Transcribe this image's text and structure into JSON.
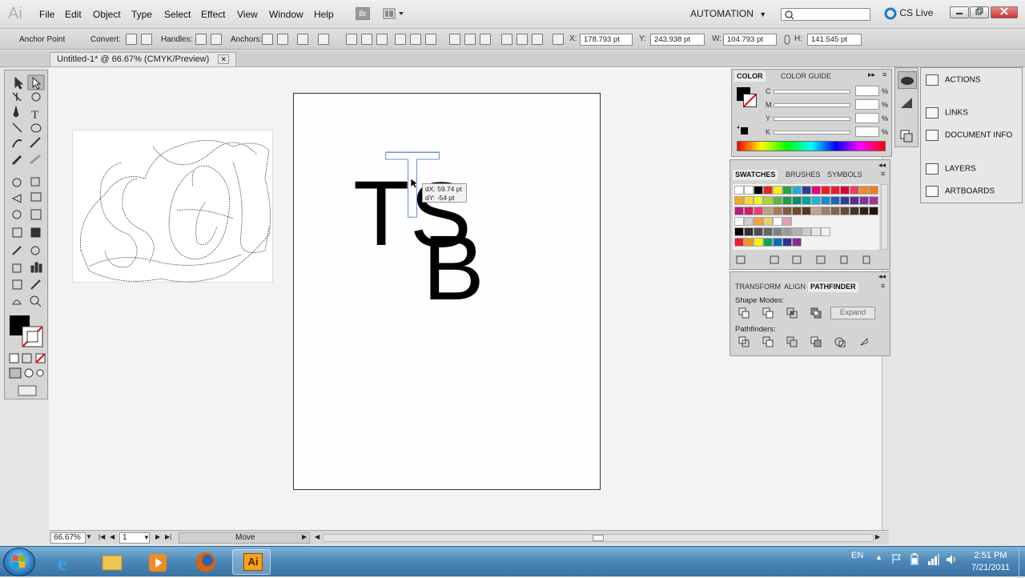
{
  "app": {
    "logo": "Ai",
    "bridge_label": "Br"
  },
  "menu": [
    "File",
    "Edit",
    "Object",
    "Type",
    "Select",
    "Effect",
    "View",
    "Window",
    "Help"
  ],
  "workspace": {
    "automation": "AUTOMATION",
    "cslive": "CS Live",
    "automation_arrow": "▼"
  },
  "control_bar": {
    "anchor_point": "Anchor Point",
    "convert": "Convert:",
    "handles": "Handles:",
    "anchors": "Anchors:",
    "x_label": "X:",
    "x_value": "178.793 pt",
    "y_label": "Y:",
    "y_value": "243.938 pt",
    "w_label": "W:",
    "w_value": "104.793 pt",
    "h_label": "H:",
    "h_value": "141.545 pt"
  },
  "document": {
    "tab_title": "Untitled-1* @ 66.67% (CMYK/Preview)",
    "tab_close": "✕"
  },
  "artwork": {
    "letter_t_outline": "T",
    "letter_t": "T",
    "letter_s": "S",
    "letter_b": "B",
    "tooltip_dx": "dX: 59.74 pt",
    "tooltip_dy": "dY: -54 pt"
  },
  "status": {
    "zoom": "66.67%",
    "page": "1",
    "tool_status": "Move"
  },
  "color_panel": {
    "tabs": [
      "COLOR",
      "COLOR GUIDE"
    ],
    "channels": [
      "C",
      "M",
      "Y",
      "K"
    ],
    "percent": "%"
  },
  "swatches_panel": {
    "tabs": [
      "SWATCHES",
      "BRUSHES",
      "SYMBOLS"
    ],
    "row1": [
      "#ffffff",
      "#ffffff",
      "#000000",
      "#e8241f",
      "#f7ec13",
      "#26a343",
      "#2aa7e0",
      "#2a3b91",
      "#e6007e",
      "#ed1c24",
      "#e71d36",
      "#d6003d",
      "#f03c5b",
      "#ee8b1f",
      "#f47b20"
    ],
    "row2": [
      "#f5a623",
      "#fdd835",
      "#eef230",
      "#b3d334",
      "#5cb543",
      "#1f9a48",
      "#0b8a63",
      "#02a09a",
      "#1fb2d6",
      "#1b8ccf",
      "#2163b3",
      "#2f3d92",
      "#5a2d91",
      "#7a3894",
      "#a3368e"
    ],
    "row3": [
      "#c2187d",
      "#d11e5a",
      "#e63e6d",
      "#c29d7a",
      "#a8795a",
      "#87593e",
      "#6e4a32",
      "#553722",
      "#bfa78d",
      "#9b8166",
      "#7a654e",
      "#5d4c3a",
      "#423427",
      "#2f241b",
      "#1e1711"
    ],
    "row4": [
      "#ffffff",
      "#cfcfcf",
      "#f4a23a",
      "#e8d26a",
      "#ffffff",
      "#e3a0b8"
    ],
    "row5": [
      "#000000",
      "#333333",
      "#4d4d4d",
      "#666666",
      "#808080",
      "#999999",
      "#b3b3b3",
      "#cccccc",
      "#e6e6e6",
      "#f2f2f2"
    ],
    "row6": [
      "#ed1c24",
      "#f7941d",
      "#fff200",
      "#00a651",
      "#0072bc",
      "#2e3192",
      "#92278f"
    ]
  },
  "pathfinder_panel": {
    "tabs": [
      "TRANSFORM",
      "ALIGN",
      "PATHFINDER"
    ],
    "shape_modes": "Shape Modes:",
    "expand": "Expand",
    "pathfinders": "Pathfinders:"
  },
  "dock": [
    "ACTIONS",
    "LINKS",
    "DOCUMENT INFO",
    "LAYERS",
    "ARTBOARDS"
  ],
  "taskbar": {
    "lang": "EN",
    "time": "2:51 PM",
    "date": "7/21/2011",
    "ai_label": "Ai"
  },
  "colors": {
    "accent": "#3b73a3",
    "fill": "#000000",
    "stroke": "#ffffff",
    "selection": "#4a7fd6"
  }
}
